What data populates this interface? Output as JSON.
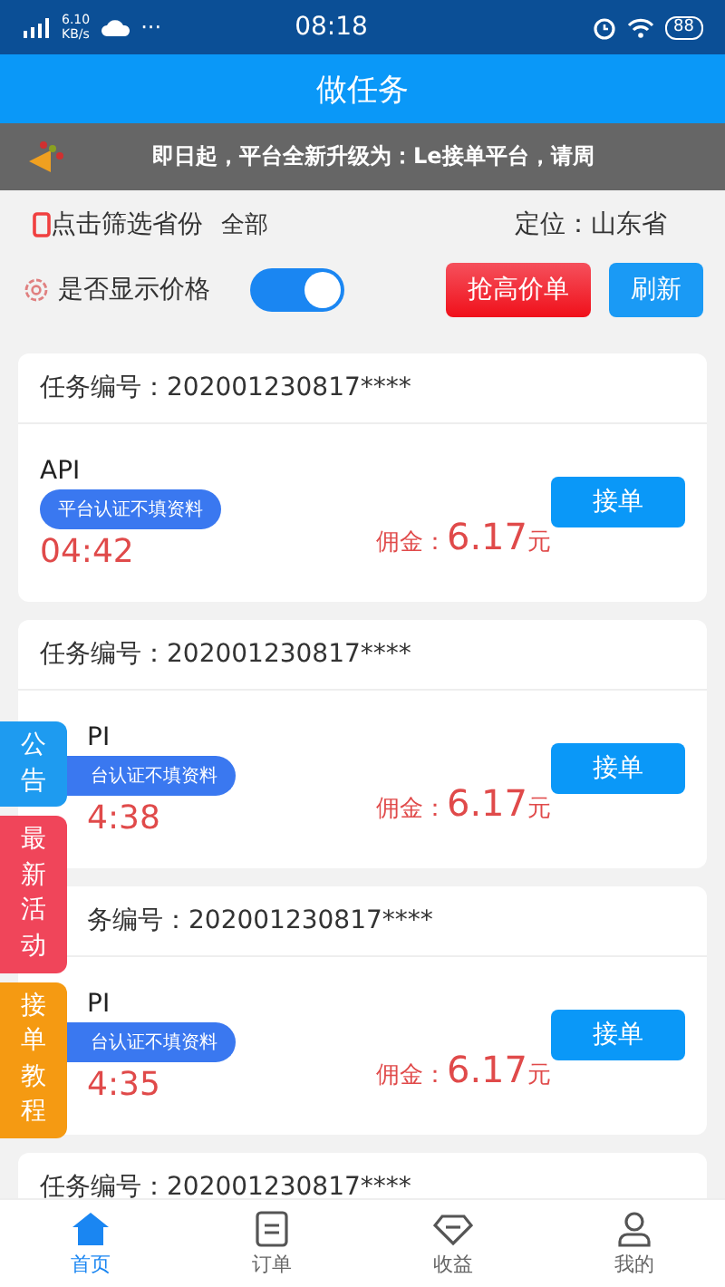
{
  "status_bar": {
    "speed": "6.10",
    "speed_unit": "KB/s",
    "more": "···",
    "time": "08:18",
    "battery": "88"
  },
  "header": {
    "title": "做任务"
  },
  "notice": {
    "text": "即日起，平台全新升级为：Le接单平台，请周"
  },
  "filter": {
    "label": "点击筛选省份",
    "value": "全部",
    "location": "定位：山东省"
  },
  "price_toggle": {
    "label": "是否显示价格",
    "on": true
  },
  "actions": [
    {
      "label": "抢高价单",
      "kind": "hot"
    },
    {
      "label": "刷新",
      "kind": "plain"
    }
  ],
  "tasks": [
    {
      "number": "任务编号：202001230817****",
      "name": "API",
      "tag": "平台认证不填资料",
      "timer": "04:42",
      "commission_label": "佣金：",
      "amount": "6.17",
      "unit": "元",
      "button": "接单"
    },
    {
      "kind": "behind_tabs",
      "number": "任务编号：202001230817****",
      "name": "PI",
      "tag": "台认证不填资料",
      "timer": "4:38",
      "commission_label": "佣金：",
      "amount": "6.17",
      "unit": "元",
      "button": "接单"
    },
    {
      "kind": "behind_tabs",
      "number": "务编号：202001230817****",
      "name": "PI",
      "tag": "台认证不填资料",
      "timer": "4:35",
      "commission_label": "佣金：",
      "amount": "6.17",
      "unit": "元",
      "button": "接单"
    },
    {
      "number": "任务编号：202001230817****"
    }
  ],
  "side_tabs": [
    {
      "label": "公告",
      "color": "#1e9bf0"
    },
    {
      "label": "最新活动",
      "color": "#f0455a"
    },
    {
      "label": "接单教程",
      "color": "#f59a12"
    }
  ],
  "bottom_nav": [
    {
      "label": "首页",
      "selected": true
    },
    {
      "label": "订单",
      "selected": false
    },
    {
      "label": "收益",
      "selected": false
    },
    {
      "label": "我的",
      "selected": false
    }
  ]
}
